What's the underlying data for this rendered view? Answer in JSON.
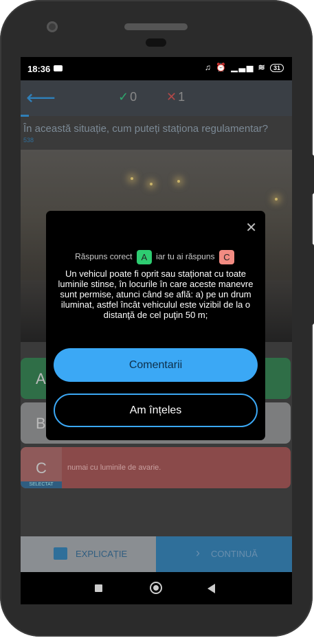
{
  "status": {
    "time": "18:36",
    "battery": "31"
  },
  "header": {
    "correct_count": "0",
    "wrong_count": "1"
  },
  "question": {
    "text": "În această situație, cum puteți staționa regulamentar?",
    "id": "538"
  },
  "answers": [
    {
      "letter": "A",
      "text": ""
    },
    {
      "letter": "B",
      "text": ""
    },
    {
      "letter": "C",
      "text": "numai cu luminile de avarie.",
      "selected_label": "SELECTAT"
    }
  ],
  "bottom": {
    "explain_label": "EXPLICAȚIE",
    "continue_label": "CONTINUĂ"
  },
  "modal": {
    "correct_prefix": "Răspuns corect",
    "correct_letter": "A",
    "middle_text": "iar tu ai răspuns",
    "user_letter": "C",
    "explanation": "Un vehicul poate fi oprit sau staționat cu toate luminile stinse, în locurile în care aceste manevre sunt permise, atunci când se află: a) pe un drum iluminat, astfel încât vehiculul este vizibil de la o distanţă de cel puţin 50 m;",
    "comments_button": "Comentarii",
    "understood_button": "Am înțeles"
  },
  "colors": {
    "accent": "#3ba8f5",
    "correct": "#2ecc71",
    "wrong": "#f28b82"
  },
  "icons": [
    "back-arrow-icon",
    "check-icon",
    "cross-icon",
    "close-icon",
    "book-icon",
    "chevron-right-icon"
  ]
}
